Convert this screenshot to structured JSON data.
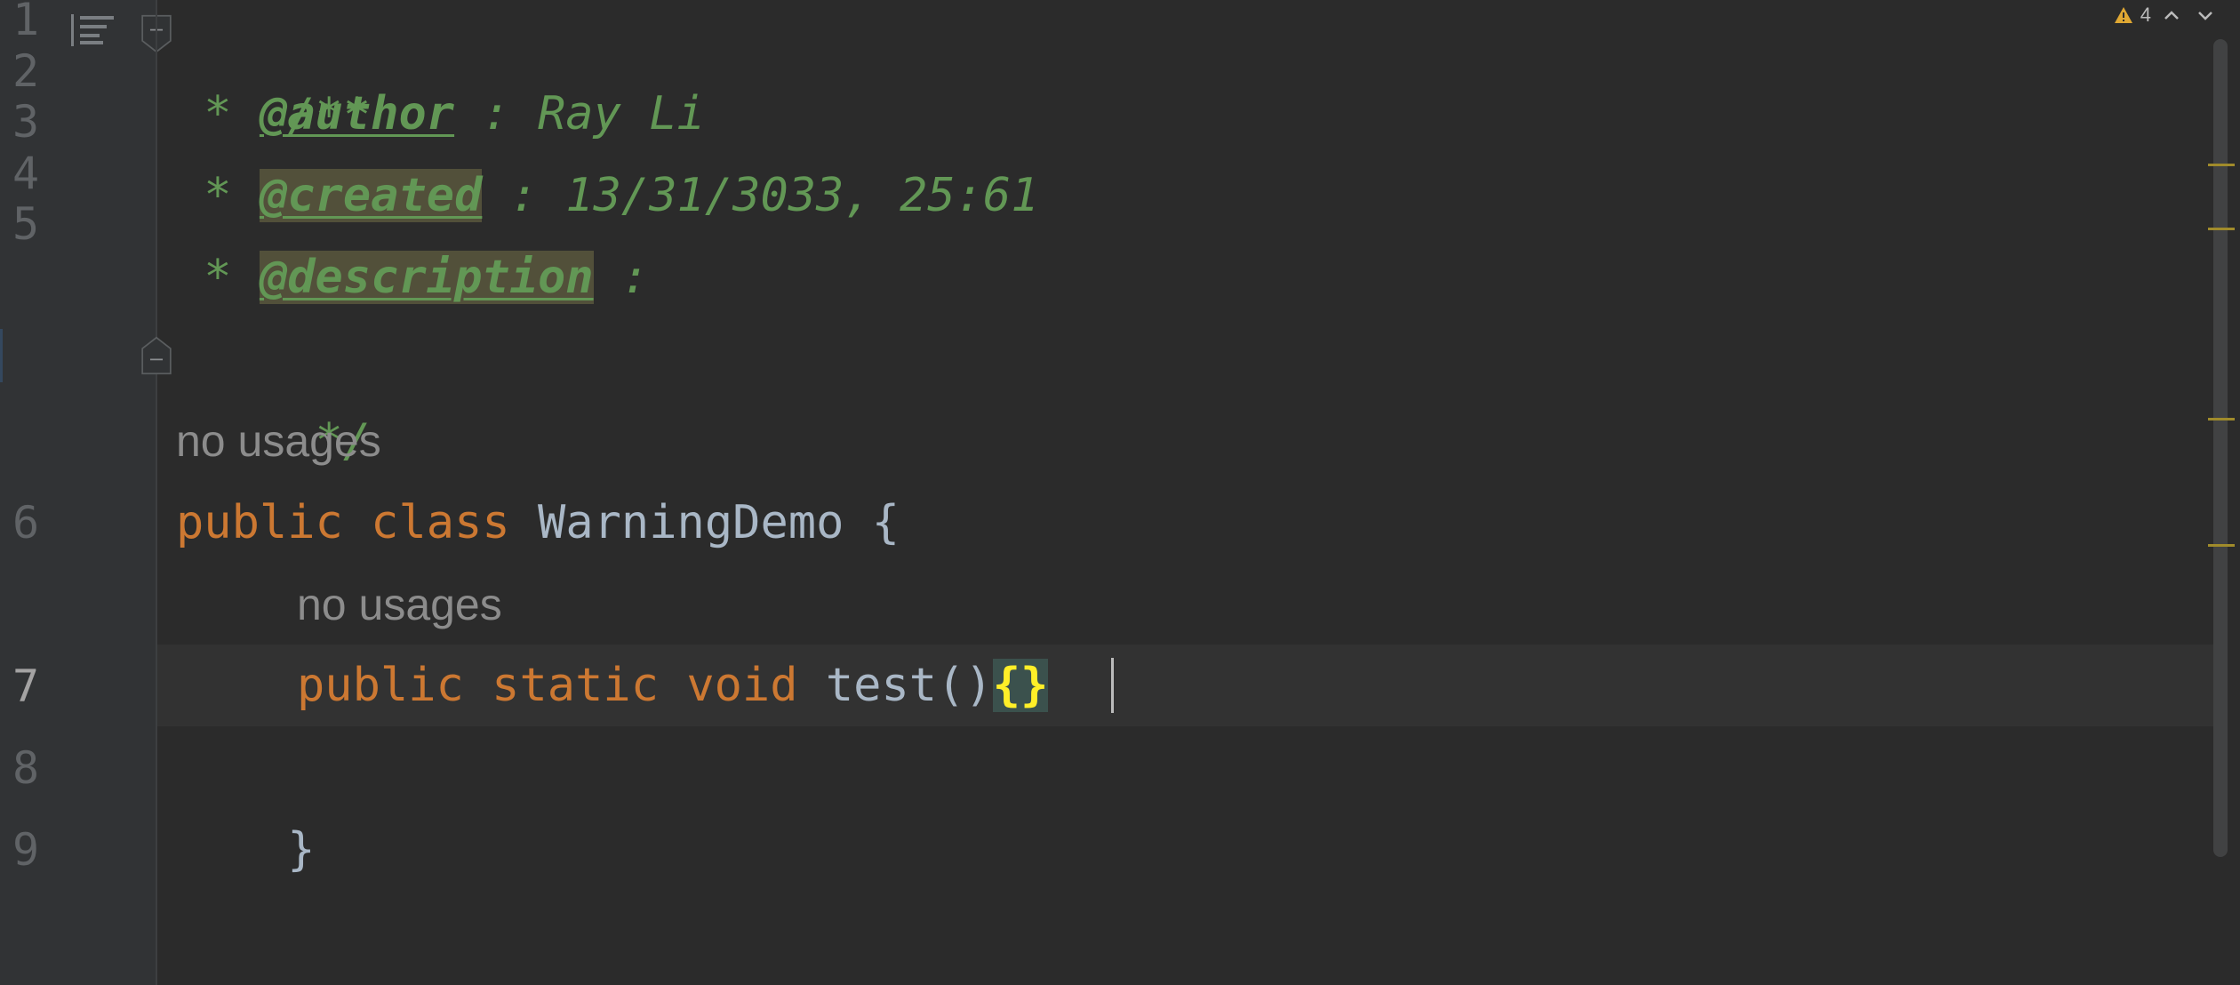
{
  "editor": {
    "lines": [
      {
        "number": "1"
      },
      {
        "number": "2"
      },
      {
        "number": "3"
      },
      {
        "number": "4"
      },
      {
        "number": "5"
      },
      {
        "number": "6"
      },
      {
        "number": "7"
      },
      {
        "number": "8"
      },
      {
        "number": "9"
      }
    ],
    "code": {
      "line1": "/**",
      "line2_prefix": " * ",
      "line2_tag": "@author",
      "line2_rest": " : Ray Li",
      "line3_prefix": " * ",
      "line3_tag": "@created",
      "line3_rest": " : 13/31/3033, 25:61",
      "line4_prefix": " * ",
      "line4_tag": "@description",
      "line4_rest": " :",
      "line5": " */",
      "line6_kw1": "public",
      "line6_kw2": "class",
      "line6_name": "WarningDemo",
      "line6_brace": "{",
      "line7_kw1": "public",
      "line7_kw2": "static",
      "line7_kw3": "void",
      "line7_method": "test",
      "line7_parens": "()",
      "line7_braces": "{}",
      "line8": "}"
    },
    "hints": {
      "class_usages": "no usages",
      "method_usages": "no usages"
    },
    "inspection": {
      "warning_count": "4",
      "prev_label": "^",
      "next_label": "v"
    },
    "colors": {
      "background": "#2b2b2b",
      "keyword": "#cc7832",
      "doc_comment": "#629755",
      "identifier": "#a9b7c6",
      "line_number": "#606366",
      "brace_match": "#ffef28",
      "warning": "#e0a833"
    },
    "icons": {
      "structure": "structure-icon",
      "fold": "fold-icon",
      "warning": "warning-icon"
    }
  }
}
